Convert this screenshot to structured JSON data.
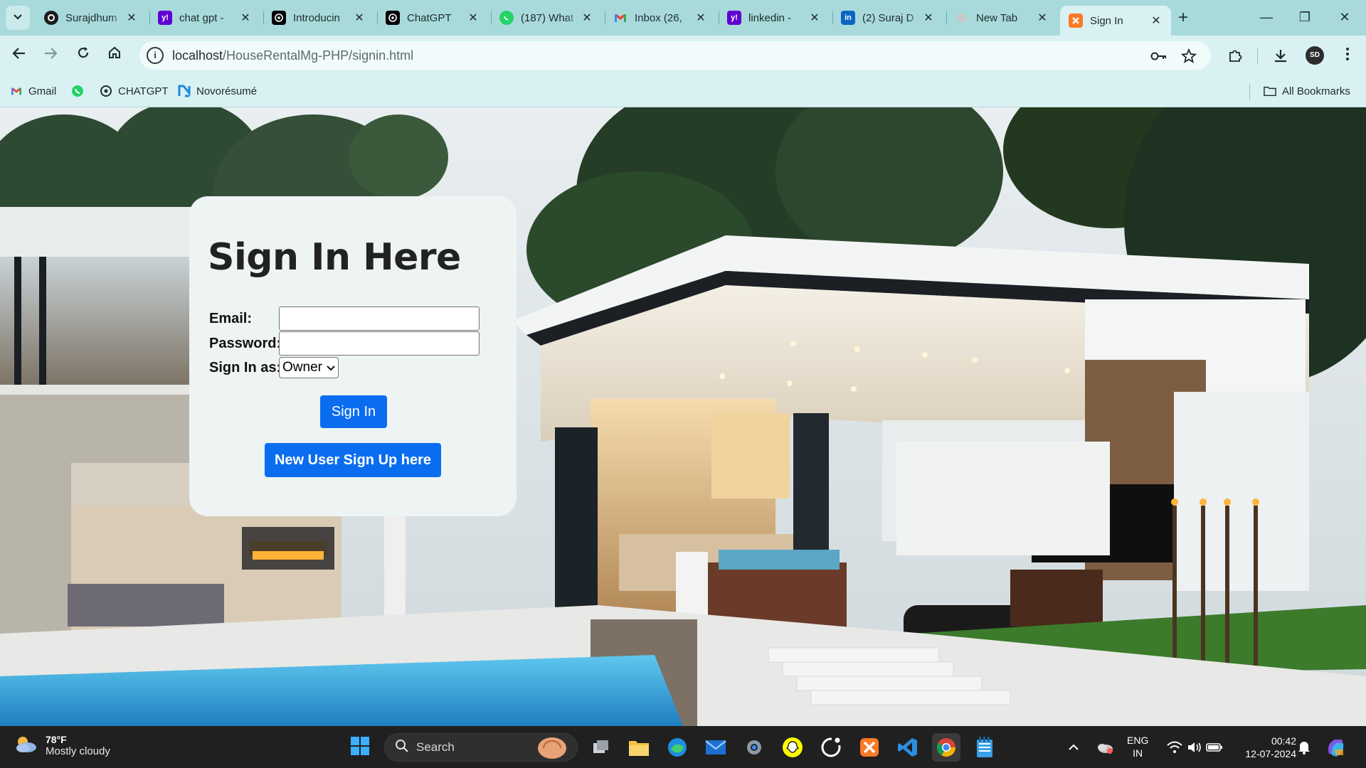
{
  "browser": {
    "tabs": [
      {
        "title": "Surajdhum",
        "favicon": "github-icon"
      },
      {
        "title": "chat gpt -",
        "favicon": "yahoo-icon"
      },
      {
        "title": "Introducin",
        "favicon": "openai-icon"
      },
      {
        "title": "ChatGPT",
        "favicon": "openai-icon"
      },
      {
        "title": "(187) What",
        "favicon": "whatsapp-icon"
      },
      {
        "title": "Inbox (26,",
        "favicon": "gmail-icon"
      },
      {
        "title": "linkedin - ",
        "favicon": "yahoo-icon"
      },
      {
        "title": "(2) Suraj D",
        "favicon": "linkedin-icon"
      },
      {
        "title": "New Tab",
        "favicon": "newtab-icon"
      },
      {
        "title": "Sign In",
        "favicon": "xampp-icon",
        "active": true
      }
    ],
    "url_host": "localhost",
    "url_path": "/HouseRentalMg-PHP/signin.html",
    "bookmarks": [
      {
        "label": "Gmail",
        "icon": "gmail-icon"
      },
      {
        "label": "",
        "icon": "whatsapp-icon"
      },
      {
        "label": "CHATGPT",
        "icon": "openai-icon"
      },
      {
        "label": "Novorésumé",
        "icon": "novoresume-icon"
      }
    ],
    "all_bookmarks": "All Bookmarks",
    "avatar_initials": "SD"
  },
  "signin": {
    "heading": "Sign In Here",
    "email_label": "Email:",
    "password_label": "Password:",
    "role_label": "Sign In as:",
    "role_selected": "Owner",
    "signin_button": "Sign In",
    "signup_button": "New User Sign Up here"
  },
  "taskbar": {
    "temperature": "78°F",
    "weather": "Mostly cloudy",
    "search_placeholder": "Search",
    "lang_top": "ENG",
    "lang_bottom": "IN",
    "time": "00:42",
    "date": "12-07-2024"
  },
  "colors": {
    "browser_frame": "#a8dadb",
    "toolbar": "#d9f1f2",
    "button": "#0a6df0",
    "card": "#eef3f4"
  }
}
